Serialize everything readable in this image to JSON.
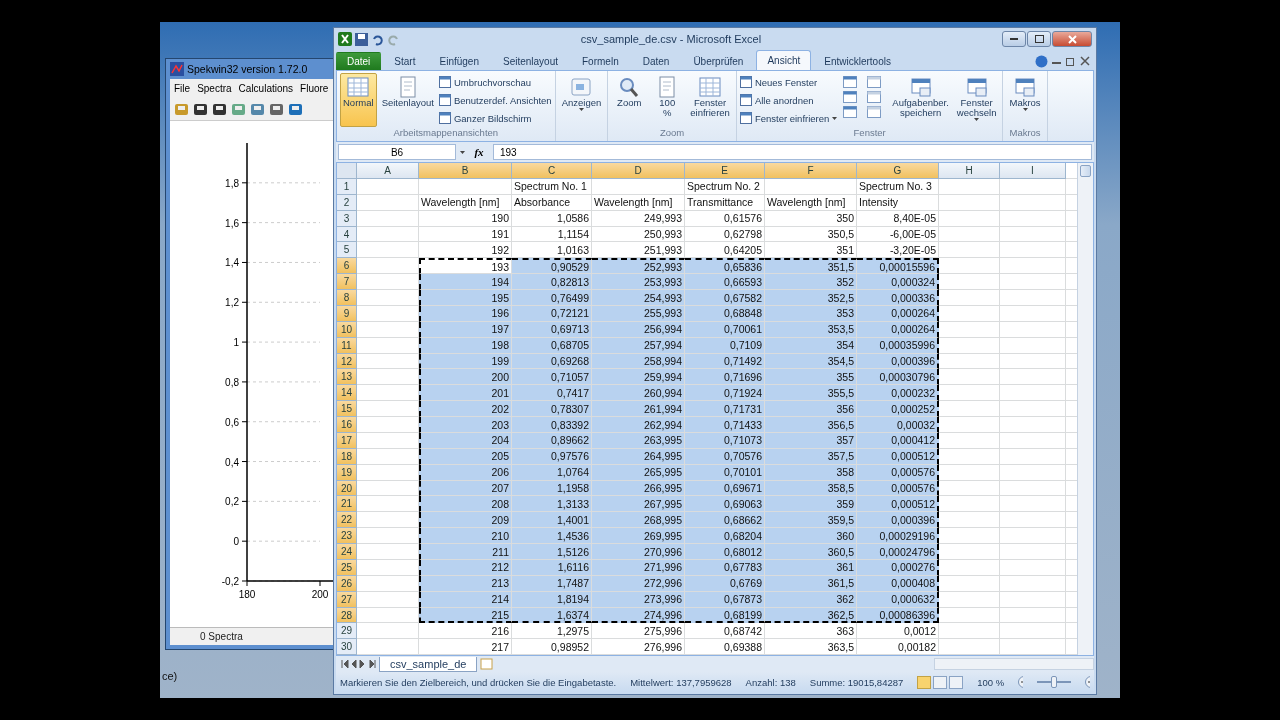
{
  "desktop": {
    "fragment": "ce)"
  },
  "spekwin": {
    "title": "Spekwin32 version 1.72.0",
    "menu": [
      "File",
      "Spectra",
      "Calculations",
      "Fluore"
    ],
    "chart_data": {
      "type": "line",
      "grid": true,
      "xlim": [
        180,
        200
      ],
      "ylim": [
        -0.2,
        2.0
      ],
      "xticks": [
        180,
        200
      ],
      "yticks": [
        {
          "value": 1.8,
          "label": "1,8"
        },
        {
          "value": 1.6,
          "label": "1,6"
        },
        {
          "value": 1.4,
          "label": "1,4"
        },
        {
          "value": 1.2,
          "label": "1,2"
        },
        {
          "value": 1,
          "label": "1"
        },
        {
          "value": 0.8,
          "label": "0,8"
        },
        {
          "value": 0.6,
          "label": "0,6"
        },
        {
          "value": 0.4,
          "label": "0,4"
        },
        {
          "value": 0.2,
          "label": "0,2"
        },
        {
          "value": 0,
          "label": "0"
        },
        {
          "value": -0.2,
          "label": "-0,2"
        }
      ]
    },
    "status": "0 Spectra"
  },
  "excel": {
    "title": "csv_sample_de.csv - Microsoft Excel",
    "tabs": [
      {
        "label": "Datei",
        "kind": "file",
        "selected": false
      },
      {
        "label": "Start",
        "kind": "tab",
        "selected": false
      },
      {
        "label": "Einfügen",
        "kind": "tab",
        "selected": false
      },
      {
        "label": "Seitenlayout",
        "kind": "tab",
        "selected": false
      },
      {
        "label": "Formeln",
        "kind": "tab",
        "selected": false
      },
      {
        "label": "Daten",
        "kind": "tab",
        "selected": false
      },
      {
        "label": "Überprüfen",
        "kind": "tab",
        "selected": false
      },
      {
        "label": "Ansicht",
        "kind": "tab",
        "selected": true
      },
      {
        "label": "Entwicklertools",
        "kind": "tab",
        "selected": false
      }
    ],
    "ribbon": [
      {
        "label": "Arbeitsmappenansichten",
        "items": [
          {
            "kind": "large",
            "lines": [
              "Normal"
            ],
            "selected": true
          },
          {
            "kind": "large",
            "lines": [
              "Seitenlayout"
            ],
            "selected": false
          },
          {
            "kind": "stack",
            "items": [
              {
                "label": "Umbruchvorschau"
              },
              {
                "label": "Benutzerdef. Ansichten"
              },
              {
                "label": "Ganzer Bildschirm"
              }
            ]
          }
        ]
      },
      {
        "items": [
          {
            "kind": "large",
            "lines": [
              "Anzeigen"
            ],
            "dropdown": true,
            "selected": false
          }
        ]
      },
      {
        "label": "Zoom",
        "items": [
          {
            "kind": "large",
            "lines": [
              "Zoom"
            ],
            "selected": false
          },
          {
            "kind": "large",
            "lines": [
              "100",
              "%"
            ],
            "selected": false
          },
          {
            "kind": "large",
            "lines": [
              "Fenster",
              "einfrieren"
            ],
            "selected": false
          }
        ]
      },
      {
        "label": "Fenster",
        "items": [
          {
            "kind": "stack",
            "items": [
              {
                "label": "Neues Fenster"
              },
              {
                "label": "Alle anordnen"
              },
              {
                "label": "Fenster einfrieren",
                "dropdown": true
              }
            ]
          },
          {
            "kind": "icon-grid"
          },
          {
            "kind": "large",
            "lines": [
              "Aufgabenber.",
              "speichern"
            ],
            "selected": false
          },
          {
            "kind": "large",
            "lines": [
              "Fenster",
              "wechseln"
            ],
            "dropdown": true,
            "selected": false
          }
        ]
      },
      {
        "label": "Makros",
        "items": [
          {
            "kind": "large",
            "lines": [
              "Makros"
            ],
            "dropdown": true,
            "selected": false
          }
        ]
      }
    ],
    "name_box": "B6",
    "function_label": "fx",
    "formula": "193",
    "columns": [
      {
        "letter": "A",
        "selected": false
      },
      {
        "letter": "B",
        "selected": true
      },
      {
        "letter": "C",
        "selected": true
      },
      {
        "letter": "D",
        "selected": true
      },
      {
        "letter": "E",
        "selected": true
      },
      {
        "letter": "F",
        "selected": true
      },
      {
        "letter": "G",
        "selected": true
      },
      {
        "letter": "H",
        "selected": false
      },
      {
        "letter": "I",
        "selected": false
      }
    ],
    "rows": [
      {
        "header": "1",
        "selected": false,
        "kind": "text",
        "cells": [
          {},
          {},
          {
            "text": "Spectrum No. 1"
          },
          {},
          {
            "text": "Spectrum No. 2"
          },
          {},
          {
            "text": "Spectrum No. 3"
          }
        ]
      },
      {
        "header": "2",
        "selected": false,
        "kind": "text",
        "cells": [
          {},
          {
            "text": "Wavelength [nm]"
          },
          {
            "text": "Absorbance"
          },
          {
            "text": "Wavelength [nm]"
          },
          {
            "text": "Transmittance"
          },
          {
            "text": "Wavelength [nm]"
          },
          {
            "text": "Intensity"
          }
        ]
      },
      {
        "header": "3",
        "selected": false,
        "kind": "number",
        "cells": [
          {},
          {
            "text": "190"
          },
          {
            "text": "1,0586"
          },
          {
            "text": "249,993"
          },
          {
            "text": "0,61576"
          },
          {
            "text": "350"
          },
          {
            "text": "8,40E-05"
          }
        ]
      },
      {
        "header": "4",
        "selected": false,
        "kind": "number",
        "cells": [
          {},
          {
            "text": "191"
          },
          {
            "text": "1,1154"
          },
          {
            "text": "250,993"
          },
          {
            "text": "0,62798"
          },
          {
            "text": "350,5"
          },
          {
            "text": "-6,00E-05"
          }
        ]
      },
      {
        "header": "5",
        "selected": false,
        "kind": "number",
        "cells": [
          {},
          {
            "text": "192"
          },
          {
            "text": "1,0163"
          },
          {
            "text": "251,993"
          },
          {
            "text": "0,64205"
          },
          {
            "text": "351"
          },
          {
            "text": "-3,20E-05"
          }
        ]
      },
      {
        "header": "6",
        "selected": true,
        "kind": "number",
        "cells": [
          {},
          {
            "text": "193",
            "active": true
          },
          {
            "text": "0,90529"
          },
          {
            "text": "252,993"
          },
          {
            "text": "0,65836"
          },
          {
            "text": "351,5"
          },
          {
            "text": "0,00015596"
          }
        ]
      },
      {
        "header": "7",
        "selected": true,
        "kind": "number",
        "cells": [
          {},
          {
            "text": "194"
          },
          {
            "text": "0,82813"
          },
          {
            "text": "253,993"
          },
          {
            "text": "0,66593"
          },
          {
            "text": "352"
          },
          {
            "text": "0,000324"
          }
        ]
      },
      {
        "header": "8",
        "selected": true,
        "kind": "number",
        "cells": [
          {},
          {
            "text": "195"
          },
          {
            "text": "0,76499"
          },
          {
            "text": "254,993"
          },
          {
            "text": "0,67582"
          },
          {
            "text": "352,5"
          },
          {
            "text": "0,000336"
          }
        ]
      },
      {
        "header": "9",
        "selected": true,
        "kind": "number",
        "cells": [
          {},
          {
            "text": "196"
          },
          {
            "text": "0,72121"
          },
          {
            "text": "255,993"
          },
          {
            "text": "0,68848"
          },
          {
            "text": "353"
          },
          {
            "text": "0,000264"
          }
        ]
      },
      {
        "header": "10",
        "selected": true,
        "kind": "number",
        "cells": [
          {},
          {
            "text": "197"
          },
          {
            "text": "0,69713"
          },
          {
            "text": "256,994"
          },
          {
            "text": "0,70061"
          },
          {
            "text": "353,5"
          },
          {
            "text": "0,000264"
          }
        ]
      },
      {
        "header": "11",
        "selected": true,
        "kind": "number",
        "cells": [
          {},
          {
            "text": "198"
          },
          {
            "text": "0,68705"
          },
          {
            "text": "257,994"
          },
          {
            "text": "0,7109"
          },
          {
            "text": "354"
          },
          {
            "text": "0,00035996"
          }
        ]
      },
      {
        "header": "12",
        "selected": true,
        "kind": "number",
        "cells": [
          {},
          {
            "text": "199"
          },
          {
            "text": "0,69268"
          },
          {
            "text": "258,994"
          },
          {
            "text": "0,71492"
          },
          {
            "text": "354,5"
          },
          {
            "text": "0,000396"
          }
        ]
      },
      {
        "header": "13",
        "selected": true,
        "kind": "number",
        "cells": [
          {},
          {
            "text": "200"
          },
          {
            "text": "0,71057"
          },
          {
            "text": "259,994"
          },
          {
            "text": "0,71696"
          },
          {
            "text": "355"
          },
          {
            "text": "0,00030796"
          }
        ]
      },
      {
        "header": "14",
        "selected": true,
        "kind": "number",
        "cells": [
          {},
          {
            "text": "201"
          },
          {
            "text": "0,7417"
          },
          {
            "text": "260,994"
          },
          {
            "text": "0,71924"
          },
          {
            "text": "355,5"
          },
          {
            "text": "0,000232"
          }
        ]
      },
      {
        "header": "15",
        "selected": true,
        "kind": "number",
        "cells": [
          {},
          {
            "text": "202"
          },
          {
            "text": "0,78307"
          },
          {
            "text": "261,994"
          },
          {
            "text": "0,71731"
          },
          {
            "text": "356"
          },
          {
            "text": "0,000252"
          }
        ]
      },
      {
        "header": "16",
        "selected": true,
        "kind": "number",
        "cells": [
          {},
          {
            "text": "203"
          },
          {
            "text": "0,83392"
          },
          {
            "text": "262,994"
          },
          {
            "text": "0,71433"
          },
          {
            "text": "356,5"
          },
          {
            "text": "0,00032"
          }
        ]
      },
      {
        "header": "17",
        "selected": true,
        "kind": "number",
        "cells": [
          {},
          {
            "text": "204"
          },
          {
            "text": "0,89662"
          },
          {
            "text": "263,995"
          },
          {
            "text": "0,71073"
          },
          {
            "text": "357"
          },
          {
            "text": "0,000412"
          }
        ]
      },
      {
        "header": "18",
        "selected": true,
        "kind": "number",
        "cells": [
          {},
          {
            "text": "205"
          },
          {
            "text": "0,97576"
          },
          {
            "text": "264,995"
          },
          {
            "text": "0,70576"
          },
          {
            "text": "357,5"
          },
          {
            "text": "0,000512"
          }
        ]
      },
      {
        "header": "19",
        "selected": true,
        "kind": "number",
        "cells": [
          {},
          {
            "text": "206"
          },
          {
            "text": "1,0764"
          },
          {
            "text": "265,995"
          },
          {
            "text": "0,70101"
          },
          {
            "text": "358"
          },
          {
            "text": "0,000576"
          }
        ]
      },
      {
        "header": "20",
        "selected": true,
        "kind": "number",
        "cells": [
          {},
          {
            "text": "207"
          },
          {
            "text": "1,1958"
          },
          {
            "text": "266,995"
          },
          {
            "text": "0,69671"
          },
          {
            "text": "358,5"
          },
          {
            "text": "0,000576"
          }
        ]
      },
      {
        "header": "21",
        "selected": true,
        "kind": "number",
        "cells": [
          {},
          {
            "text": "208"
          },
          {
            "text": "1,3133"
          },
          {
            "text": "267,995"
          },
          {
            "text": "0,69063"
          },
          {
            "text": "359"
          },
          {
            "text": "0,000512"
          }
        ]
      },
      {
        "header": "22",
        "selected": true,
        "kind": "number",
        "cells": [
          {},
          {
            "text": "209"
          },
          {
            "text": "1,4001"
          },
          {
            "text": "268,995"
          },
          {
            "text": "0,68662"
          },
          {
            "text": "359,5"
          },
          {
            "text": "0,000396"
          }
        ]
      },
      {
        "header": "23",
        "selected": true,
        "kind": "number",
        "cells": [
          {},
          {
            "text": "210"
          },
          {
            "text": "1,4536"
          },
          {
            "text": "269,995"
          },
          {
            "text": "0,68204"
          },
          {
            "text": "360"
          },
          {
            "text": "0,00029196"
          }
        ]
      },
      {
        "header": "24",
        "selected": true,
        "kind": "number",
        "cells": [
          {},
          {
            "text": "211"
          },
          {
            "text": "1,5126"
          },
          {
            "text": "270,996"
          },
          {
            "text": "0,68012"
          },
          {
            "text": "360,5"
          },
          {
            "text": "0,00024796"
          }
        ]
      },
      {
        "header": "25",
        "selected": true,
        "kind": "number",
        "cells": [
          {},
          {
            "text": "212"
          },
          {
            "text": "1,6116"
          },
          {
            "text": "271,996"
          },
          {
            "text": "0,67783"
          },
          {
            "text": "361"
          },
          {
            "text": "0,000276"
          }
        ]
      },
      {
        "header": "26",
        "selected": true,
        "kind": "number",
        "cells": [
          {},
          {
            "text": "213"
          },
          {
            "text": "1,7487"
          },
          {
            "text": "272,996"
          },
          {
            "text": "0,6769"
          },
          {
            "text": "361,5"
          },
          {
            "text": "0,000408"
          }
        ]
      },
      {
        "header": "27",
        "selected": true,
        "kind": "number",
        "cells": [
          {},
          {
            "text": "214"
          },
          {
            "text": "1,8194"
          },
          {
            "text": "273,996"
          },
          {
            "text": "0,67873"
          },
          {
            "text": "362"
          },
          {
            "text": "0,000632"
          }
        ]
      },
      {
        "header": "28",
        "selected": true,
        "kind": "number",
        "cells": [
          {},
          {
            "text": "215"
          },
          {
            "text": "1,6374"
          },
          {
            "text": "274,996"
          },
          {
            "text": "0,68199"
          },
          {
            "text": "362,5"
          },
          {
            "text": "0,00086396"
          }
        ]
      },
      {
        "header": "29",
        "selected": false,
        "kind": "number",
        "cells": [
          {},
          {
            "text": "216"
          },
          {
            "text": "1,2975"
          },
          {
            "text": "275,996"
          },
          {
            "text": "0,68742"
          },
          {
            "text": "363"
          },
          {
            "text": "0,0012"
          }
        ]
      },
      {
        "header": "30",
        "selected": false,
        "kind": "number",
        "cells": [
          {},
          {
            "text": "217"
          },
          {
            "text": "0,98952"
          },
          {
            "text": "276,996"
          },
          {
            "text": "0,69388"
          },
          {
            "text": "363,5"
          },
          {
            "text": "0,00182"
          }
        ]
      }
    ],
    "sheet_tabs": [
      {
        "label": "csv_sample_de",
        "selected": true
      }
    ],
    "status": {
      "message": "Markieren Sie den Zielbereich, und drücken Sie die Eingabetaste.",
      "stats": [
        "Mittelwert: 137,7959628",
        "Anzahl: 138",
        "Summe: 19015,84287"
      ],
      "views": [
        {
          "selected": true
        },
        {
          "selected": false
        },
        {
          "selected": false
        }
      ],
      "zoom": "100 %",
      "zoom_slider": {
        "level": 0.5
      }
    }
  }
}
